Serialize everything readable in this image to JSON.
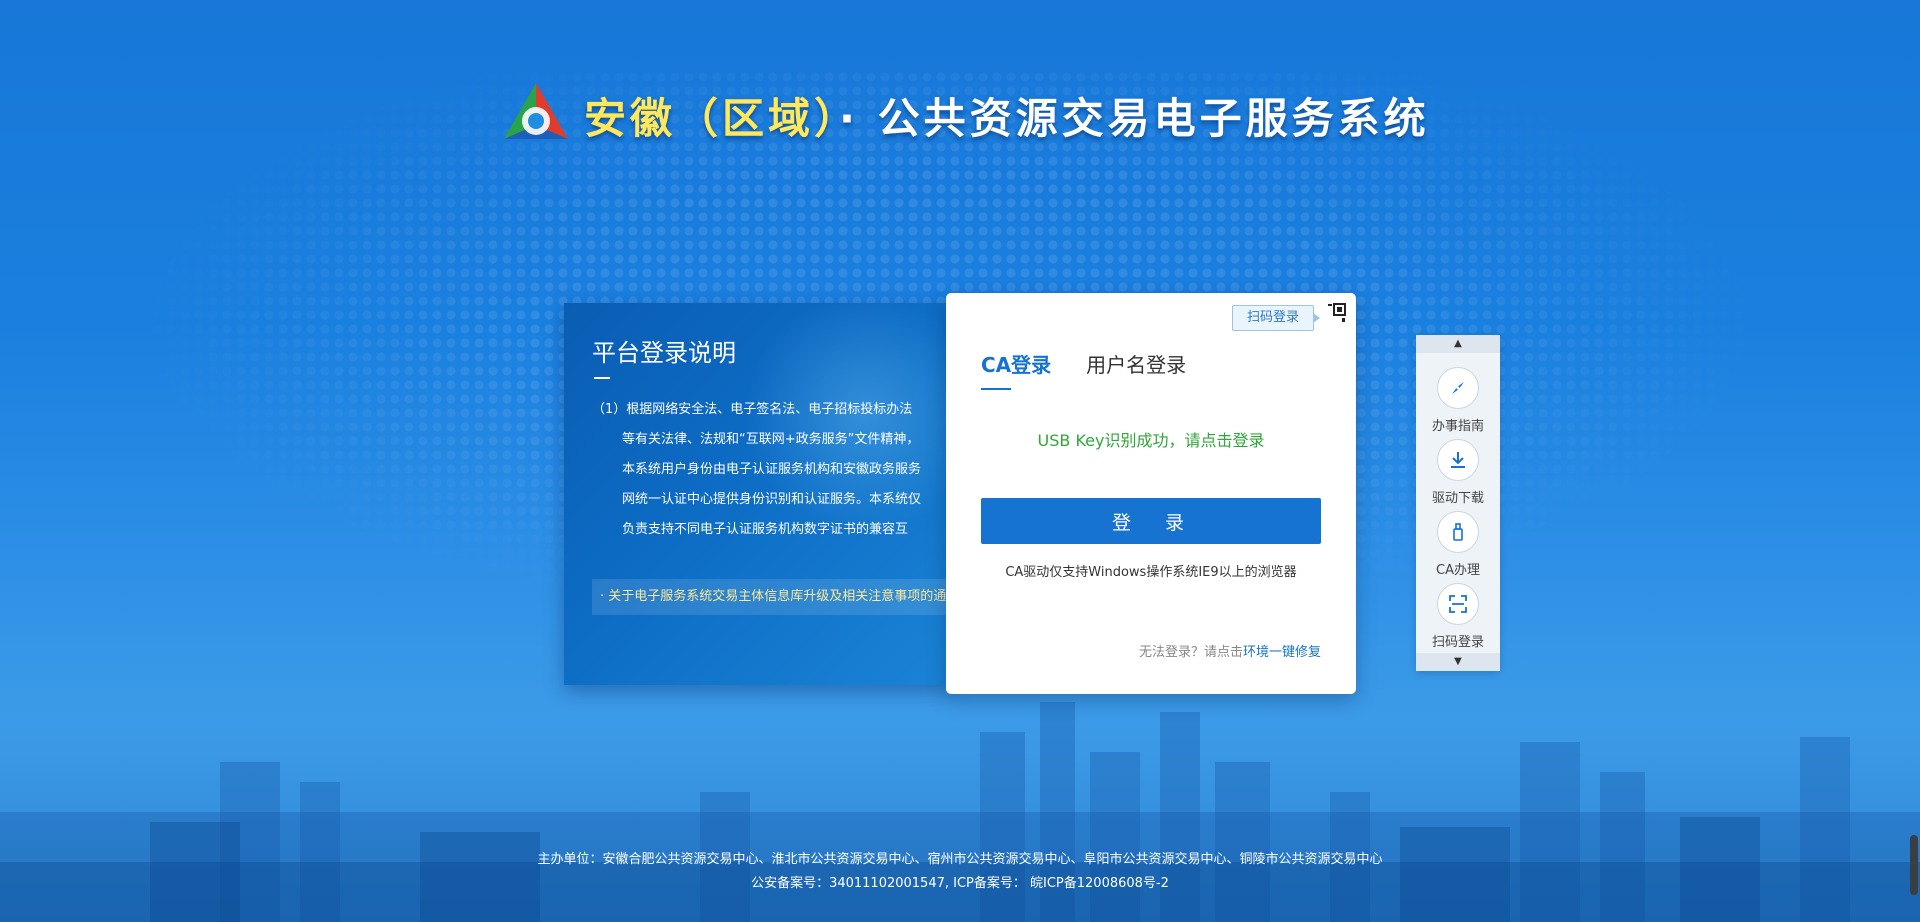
{
  "header": {
    "title_highlight": "安徽（区域）",
    "title_rest": "· 公共资源交易电子服务系统"
  },
  "info_panel": {
    "title": "平台登录说明",
    "paragraph": "（1）根据网络安全法、电子签名法、电子招标投标办法等有关法律、法规和“互联网+政务服务”文件精神，本系统用户身份由电子认证服务机构和安徽政务服务网统一认证中心提供身份识别和认证服务。本系统仅负责支持不同电子认证服务机构数字证书的兼容互",
    "notice": "· 关于电子服务系统交易主体信息库升级及相关注意事项的通"
  },
  "login": {
    "qr_tag": "扫码登录",
    "tabs": [
      {
        "label": "CA登录",
        "active": true
      },
      {
        "label": "用户名登录",
        "active": false
      }
    ],
    "status": "USB Key识别成功，请点击登录",
    "button": "登 录",
    "ca_note": "CA驱动仅支持Windows操作系统IE9以上的浏览器",
    "repair_prefix": "无法登录？请点击",
    "repair_link": "环境一键修复"
  },
  "side_menu": {
    "items": [
      {
        "label": "办事指南",
        "icon": "compass-icon"
      },
      {
        "label": "驱动下载",
        "icon": "download-icon"
      },
      {
        "label": "CA办理",
        "icon": "usb-key-icon"
      },
      {
        "label": "扫码登录",
        "icon": "scan-icon"
      }
    ]
  },
  "footer": {
    "line1": "主办单位：安徽合肥公共资源交易中心、淮北市公共资源交易中心、宿州市公共资源交易中心、阜阳市公共资源交易中心、铜陵市公共资源交易中心",
    "line2": "公安备案号：34011102001547, ICP备案号： 皖ICP备12008608号-2"
  },
  "colors": {
    "accent": "#1673d1",
    "success": "#2fa83a",
    "title_yellow": "#ffe85a"
  }
}
